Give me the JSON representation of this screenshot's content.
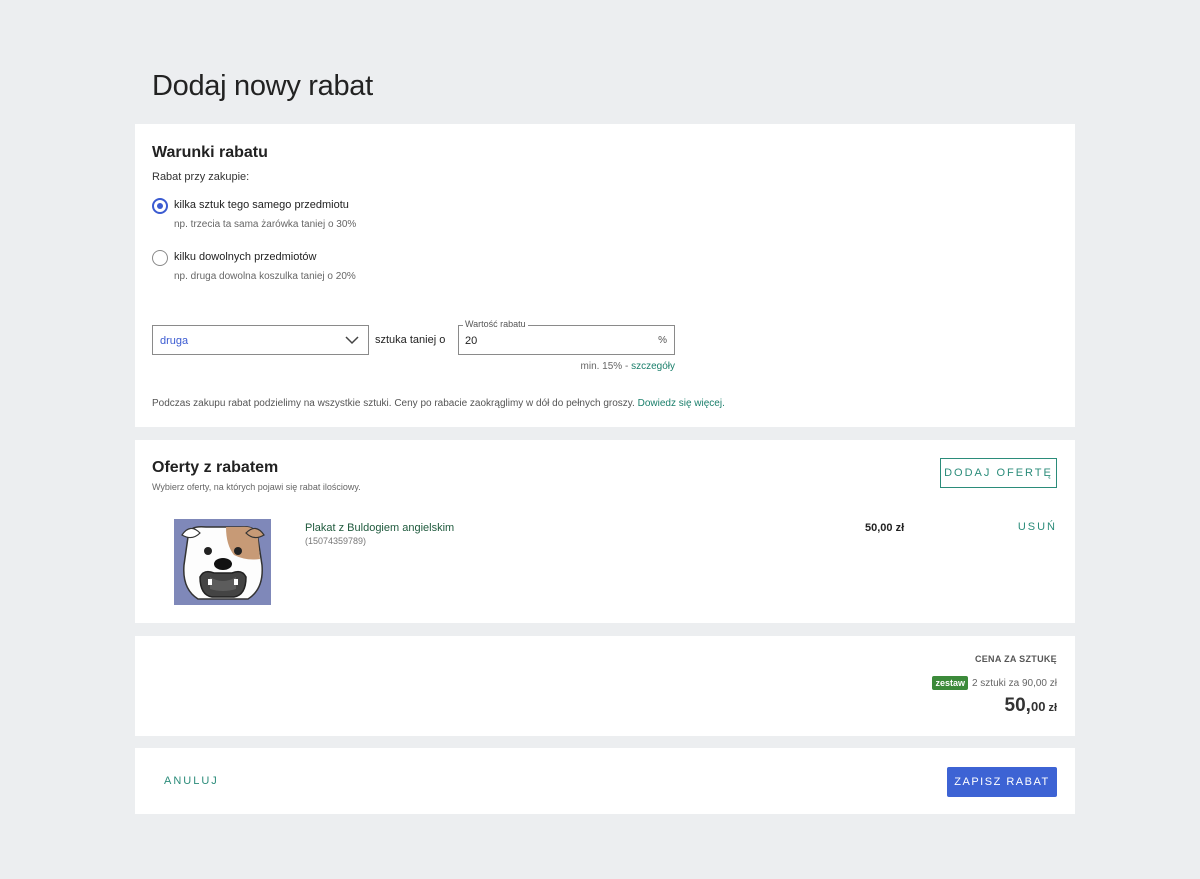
{
  "page": {
    "title": "Dodaj nowy rabat"
  },
  "conditions": {
    "heading": "Warunki rabatu",
    "subheading": "Rabat przy zakupie:",
    "options": [
      {
        "label": "kilka sztuk tego samego przedmiotu",
        "hint": "np. trzecia ta sama żarówka taniej o 30%",
        "checked": true
      },
      {
        "label": "kilku dowolnych przedmiotów",
        "hint": "np. druga dowolna koszulka taniej o 20%",
        "checked": false
      }
    ],
    "select_value": "druga",
    "mid_label": "sztuka taniej o",
    "discount_field": {
      "legend": "Wartość rabatu",
      "value": "20",
      "unit": "%"
    },
    "min_note": "min. 15% - ",
    "min_link": "szczegóły",
    "footer_note": "Podczas zakupu rabat podzielimy na wszystkie sztuki. Ceny po rabacie zaokrąglimy w dół do pełnych groszy. ",
    "footer_link": "Dowiedz się więcej."
  },
  "offers": {
    "heading": "Oferty z rabatem",
    "subheading": "Wybierz oferty, na których pojawi się rabat ilościowy.",
    "add_button": "DODAJ OFERTĘ",
    "items": [
      {
        "name": "Plakat z Buldogiem angielskim",
        "id": "(15074359789)",
        "price": "50,00 zł",
        "remove": "USUŃ"
      }
    ]
  },
  "summary": {
    "header": "CENA ZA SZTUKĘ",
    "badge": "zestaw",
    "set_text": "2 sztuki za 90,00 zł",
    "price_int": "50,",
    "price_dec": "00",
    "currency": "zł"
  },
  "actions": {
    "cancel": "ANULUJ",
    "save": "ZAPISZ RABAT"
  },
  "colors": {
    "accent": "#3d63d4",
    "link": "#2b8c7a",
    "badge": "#3c8a3a",
    "background": "#eceef0"
  }
}
